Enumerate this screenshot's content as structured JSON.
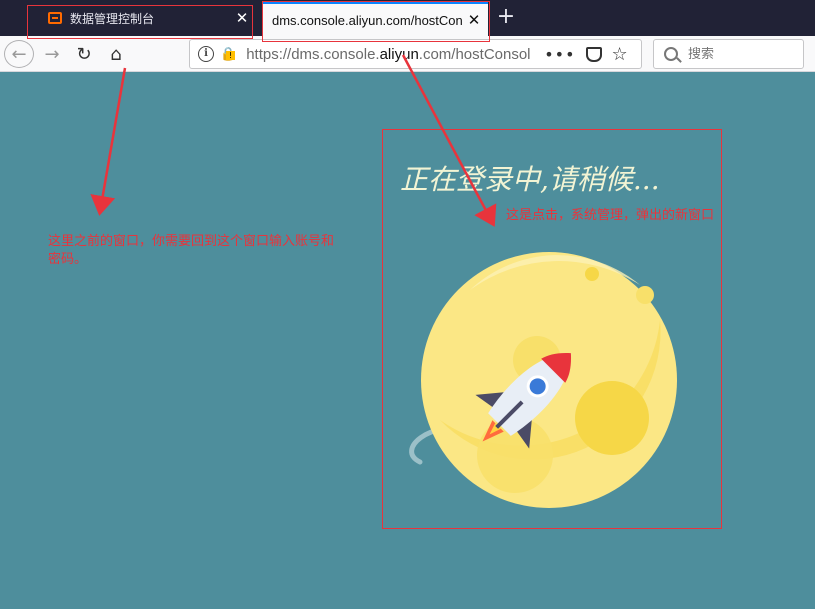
{
  "tabs": [
    {
      "title": "数据管理控制台",
      "close": "✕"
    },
    {
      "title": "dms.console.aliyun.com/hostCon",
      "close": "✕"
    }
  ],
  "new_tab_label": "+",
  "nav": {
    "back": "←",
    "forward": "→",
    "reload": "↻",
    "home": "⌂"
  },
  "url": {
    "prefix": "https://dms.console.",
    "domain": "aliyun",
    "suffix": ".com/hostConsol",
    "info_glyph": "i",
    "more_glyph": "•••",
    "star_glyph": "☆"
  },
  "search": {
    "placeholder": "搜索"
  },
  "page": {
    "status_text": "正在登录中,请稍候..."
  },
  "annotations": {
    "note_left": "这里之前的窗口，你需要回到这个窗口输入账号和密码。",
    "note_right": "这是点击，系统管理，弹出的新窗口"
  },
  "colors": {
    "annotation": "#e8343c",
    "background": "#4e8e9c",
    "moon": "#fbe785",
    "rocket_body": "#e8eef6",
    "rocket_window": "#3a7ad8"
  }
}
